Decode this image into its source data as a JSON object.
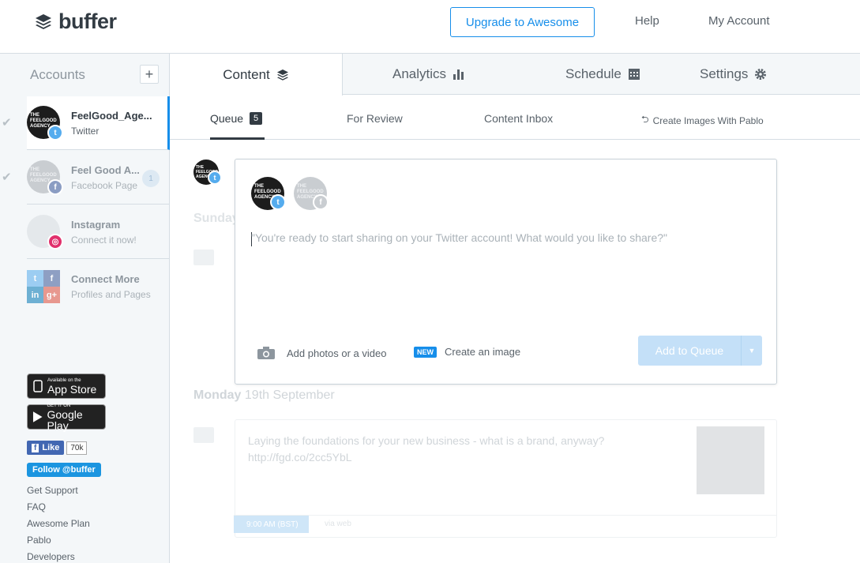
{
  "header": {
    "logo_text": "buffer",
    "upgrade_label": "Upgrade to Awesome",
    "help_label": "Help",
    "account_label": "My Account"
  },
  "sidebar": {
    "heading": "Accounts",
    "add_symbol": "+",
    "accounts": [
      {
        "avatar_text": "THE FEELGOOD AGENCY",
        "name": "FeelGood_Age...",
        "type": "Twitter",
        "network": "twitter"
      },
      {
        "avatar_text": "THE FEELGOOD AGENCY",
        "name": "Feel Good A...",
        "type": "Facebook Page",
        "network": "facebook",
        "count": "1"
      },
      {
        "name": "Instagram",
        "type": "Connect it now!",
        "network": "instagram"
      },
      {
        "name": "Connect More",
        "type": "Profiles and Pages"
      }
    ],
    "app_store": {
      "small": "Available on the",
      "big": "App Store"
    },
    "google_play": {
      "small": "GET IT ON",
      "big": "Google Play"
    },
    "fb_like": {
      "label": "Like",
      "count": "70k"
    },
    "twitter_follow": "Follow @buffer",
    "links": [
      "Get Support",
      "FAQ",
      "Awesome Plan",
      "Pablo",
      "Developers"
    ]
  },
  "tabs": {
    "content": "Content",
    "analytics": "Analytics",
    "schedule": "Schedule",
    "settings": "Settings"
  },
  "subtabs": {
    "queue": "Queue",
    "queue_count": "5",
    "review": "For Review",
    "inbox": "Content Inbox",
    "pablo": "Create Images With Pablo"
  },
  "composer": {
    "placeholder": "\"You're ready to start sharing on your Twitter account! What would you like to share?\"",
    "add_media": "Add photos or a video",
    "new_badge": "NEW",
    "create_image": "Create an image",
    "queue_button": "Add to Queue"
  },
  "queue": {
    "day1": "Sunday",
    "day2_name": "Monday",
    "day2_date": "19th September",
    "post_text": "Laying the foundations for your new business - what is a brand, anyway?",
    "post_link": "http://fgd.co/2cc5YbL",
    "post_time": "9:00 AM (BST)",
    "post_via": "via web"
  },
  "colors": {
    "accent": "#168eea",
    "text": "#323b43",
    "sidebar_bg": "#f4f7f9",
    "twitter": "#55acee"
  }
}
